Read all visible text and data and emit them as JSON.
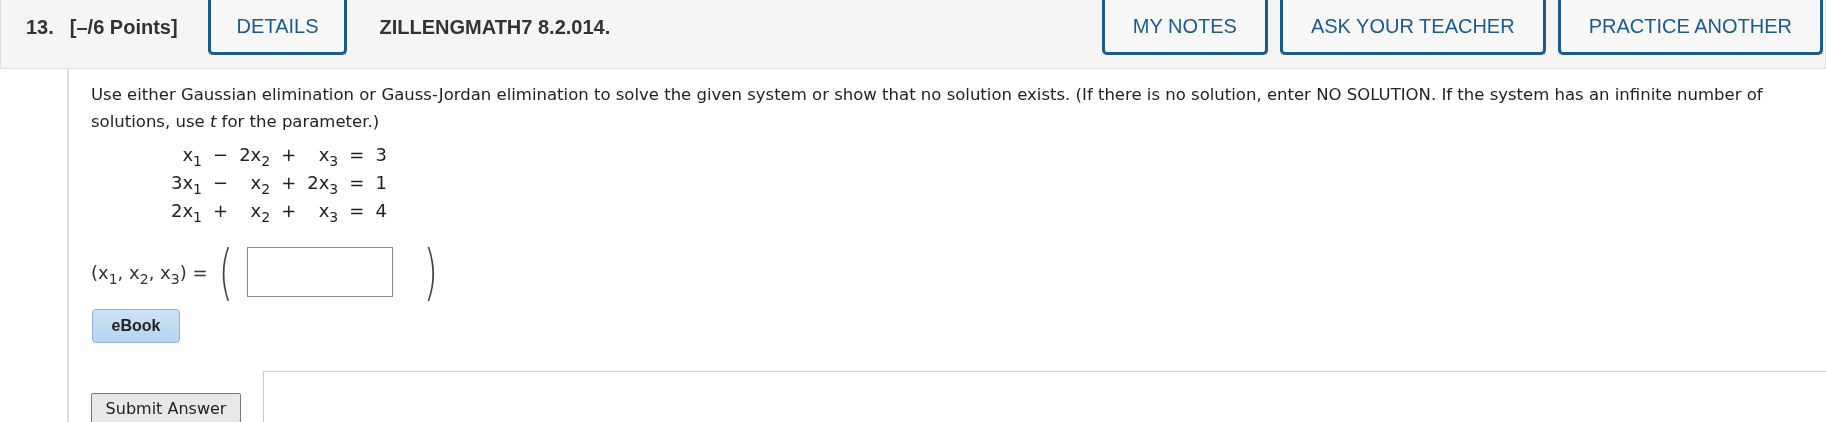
{
  "header": {
    "number": "13.",
    "points": "[–/6 Points]",
    "details_button": "DETAILS",
    "problem_code": "ZILLENGMATH7 8.2.014.",
    "buttons": [
      "MY NOTES",
      "ASK YOUR TEACHER",
      "PRACTICE ANOTHER"
    ]
  },
  "question": {
    "instructions": "Use either Gaussian elimination or Gauss-Jordan elimination to solve the given system or show that no solution exists. (If there is no solution, enter NO SOLUTION. If the system has an infinite number of solutions, use *t* for the parameter.)",
    "equations": [
      [
        "x$_{1}$",
        "−",
        "2x$_{2}$",
        "+",
        "x$_{3}$",
        "=",
        "3"
      ],
      [
        "3x$_{1}$",
        "−",
        "x$_{2}$",
        "+",
        "2x$_{3}$",
        "=",
        "1"
      ],
      [
        "2x$_{1}$",
        "+",
        "x$_{2}$",
        "+",
        "x$_{3}$",
        "=",
        "4"
      ]
    ],
    "answer_label": "(x$_{1}$, x$_{2}$, x$_{3}$) =",
    "open_paren": "(",
    "close_paren": ")"
  },
  "ebook_button": "eBook",
  "submit_button": "Submit Answer"
}
